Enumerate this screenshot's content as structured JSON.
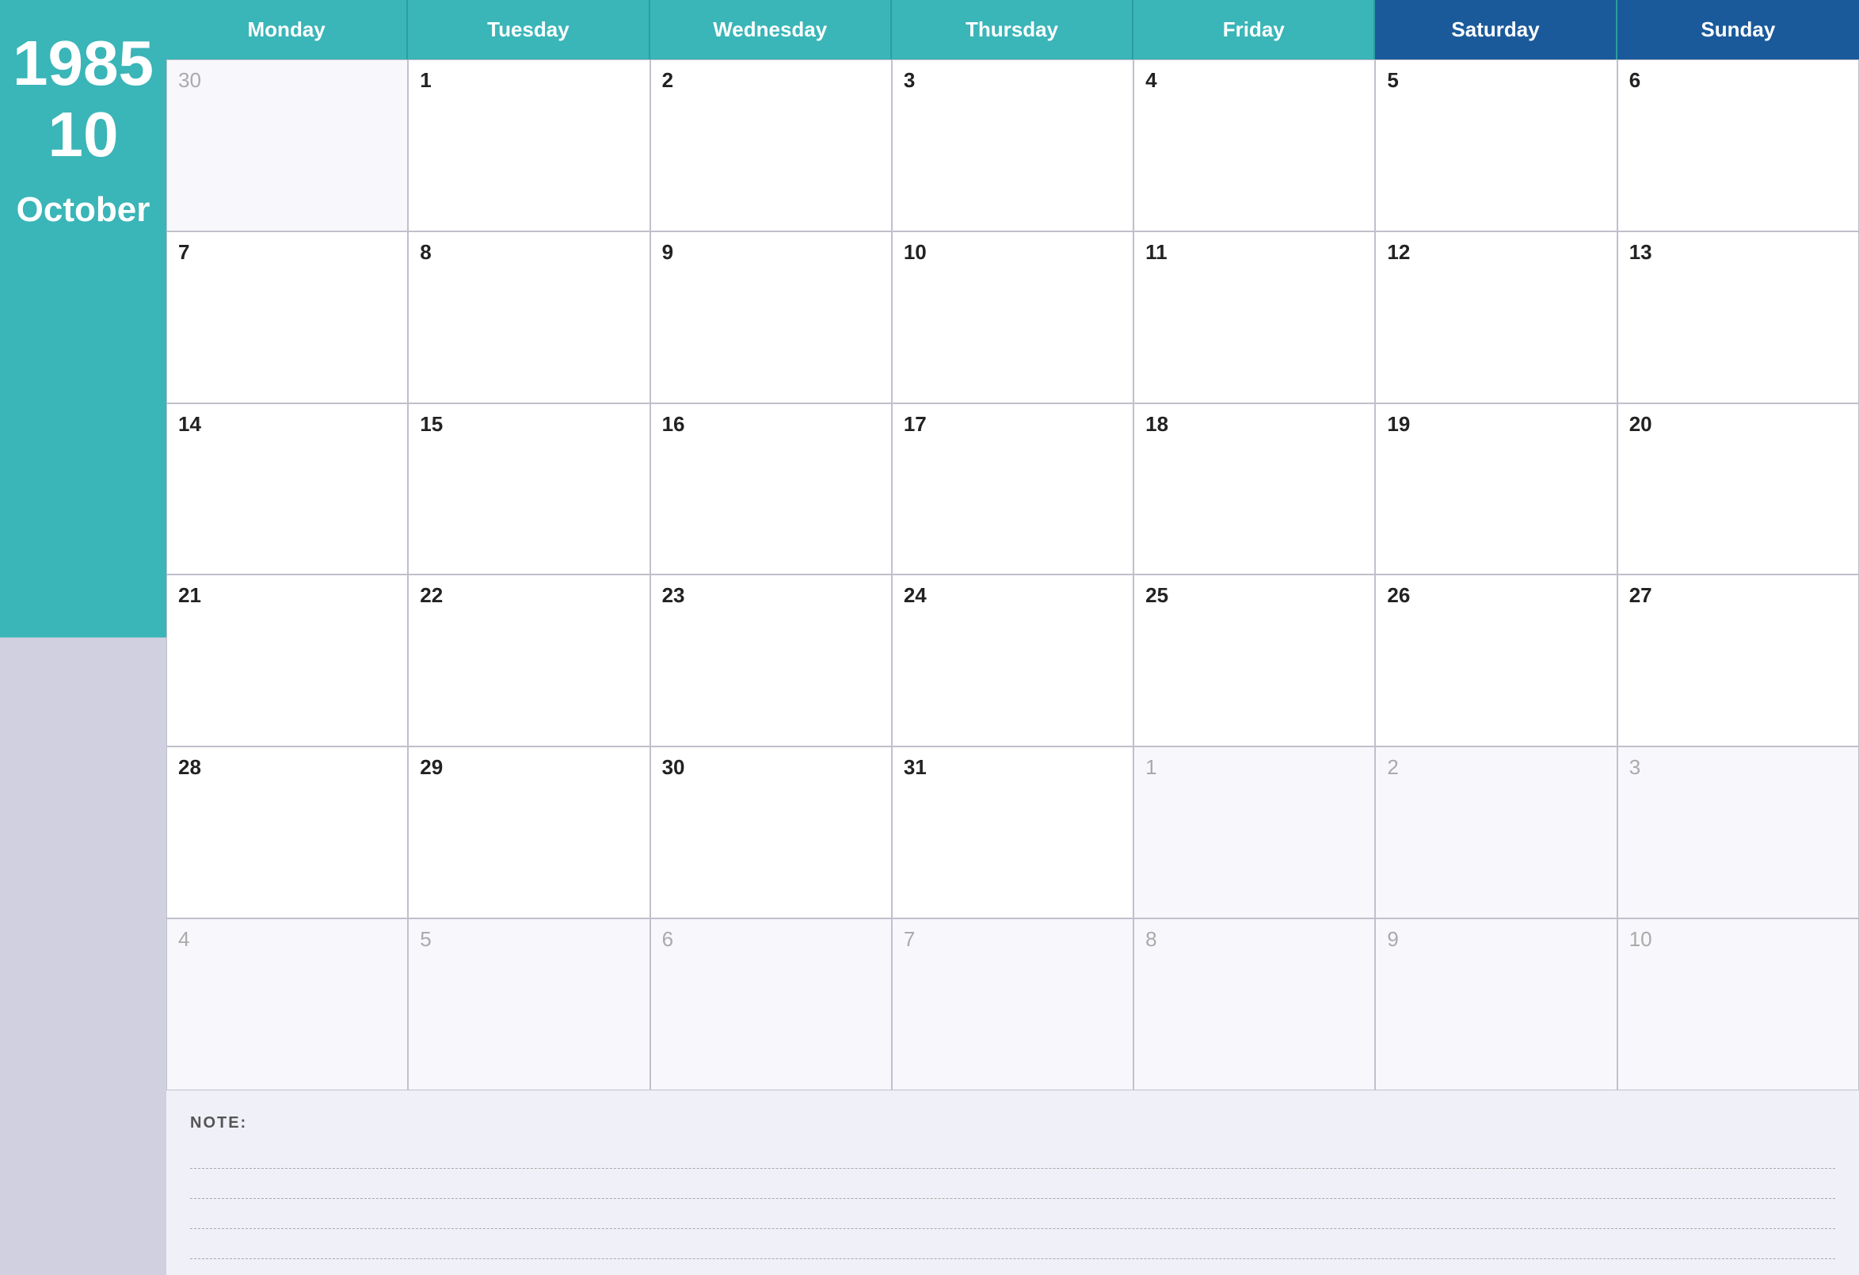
{
  "sidebar": {
    "year": "1985",
    "day": "10",
    "month": "October"
  },
  "header": {
    "days": [
      {
        "label": "Monday",
        "type": "weekday"
      },
      {
        "label": "Tuesday",
        "type": "weekday"
      },
      {
        "label": "Wednesday",
        "type": "weekday"
      },
      {
        "label": "Thursday",
        "type": "weekday"
      },
      {
        "label": "Friday",
        "type": "weekday"
      },
      {
        "label": "Saturday",
        "type": "weekend"
      },
      {
        "label": "Sunday",
        "type": "weekend"
      }
    ]
  },
  "weeks": [
    [
      {
        "number": "30",
        "type": "other-month"
      },
      {
        "number": "1",
        "type": "current"
      },
      {
        "number": "2",
        "type": "current"
      },
      {
        "number": "3",
        "type": "current"
      },
      {
        "number": "4",
        "type": "current"
      },
      {
        "number": "5",
        "type": "current"
      },
      {
        "number": "6",
        "type": "current"
      }
    ],
    [
      {
        "number": "7",
        "type": "current"
      },
      {
        "number": "8",
        "type": "current"
      },
      {
        "number": "9",
        "type": "current"
      },
      {
        "number": "10",
        "type": "current"
      },
      {
        "number": "11",
        "type": "current"
      },
      {
        "number": "12",
        "type": "current"
      },
      {
        "number": "13",
        "type": "current"
      }
    ],
    [
      {
        "number": "14",
        "type": "current"
      },
      {
        "number": "15",
        "type": "current"
      },
      {
        "number": "16",
        "type": "current"
      },
      {
        "number": "17",
        "type": "current"
      },
      {
        "number": "18",
        "type": "current"
      },
      {
        "number": "19",
        "type": "current"
      },
      {
        "number": "20",
        "type": "current"
      }
    ],
    [
      {
        "number": "21",
        "type": "current"
      },
      {
        "number": "22",
        "type": "current"
      },
      {
        "number": "23",
        "type": "current"
      },
      {
        "number": "24",
        "type": "current"
      },
      {
        "number": "25",
        "type": "current"
      },
      {
        "number": "26",
        "type": "current"
      },
      {
        "number": "27",
        "type": "current"
      }
    ],
    [
      {
        "number": "28",
        "type": "current"
      },
      {
        "number": "29",
        "type": "current"
      },
      {
        "number": "30",
        "type": "current"
      },
      {
        "number": "31",
        "type": "current"
      },
      {
        "number": "1",
        "type": "other-month"
      },
      {
        "number": "2",
        "type": "other-month"
      },
      {
        "number": "3",
        "type": "other-month"
      }
    ],
    [
      {
        "number": "4",
        "type": "other-month"
      },
      {
        "number": "5",
        "type": "other-month"
      },
      {
        "number": "6",
        "type": "other-month"
      },
      {
        "number": "7",
        "type": "other-month"
      },
      {
        "number": "8",
        "type": "other-month"
      },
      {
        "number": "9",
        "type": "other-month"
      },
      {
        "number": "10",
        "type": "other-month"
      }
    ]
  ],
  "notes": {
    "label": "NOTE:",
    "lines": [
      "",
      "",
      "",
      ""
    ]
  }
}
